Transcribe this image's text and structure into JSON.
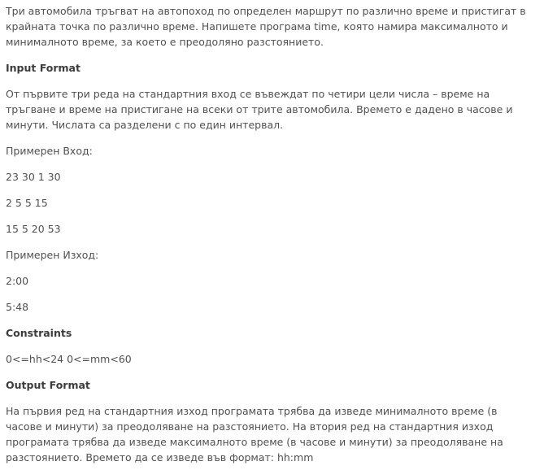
{
  "problem": {
    "intro": "Три автомобила тръгват на автопоход по определен маршрут по различно време и пристигат в крайната точка по различно време. Напишете програма time, която намира максималното и минималното време, за което е преодоляно разстоянието.",
    "input_format": {
      "heading": "Input Format",
      "text": "От първите три реда на стандартния вход се въвеждат по четири цели числа – време на тръгване и време на пристигане на всеки от трите автомобила. Времето е дадено в часове и минути. Числата са разделени с по един интервал.",
      "sample_input_label": "Примерен Вход:",
      "sample_input_lines": [
        "23 30 1 30",
        "2 5 5 15",
        "15 5 20 53"
      ],
      "sample_output_label": "Примерен Изход:",
      "sample_output_lines": [
        "2:00",
        "5:48"
      ]
    },
    "constraints": {
      "heading": "Constraints",
      "text": "0<=hh<24 0<=mm<60"
    },
    "output_format": {
      "heading": "Output Format",
      "text": "На първия ред на стандартния изход програмата трябва да изведе минималното време (в часове и минути) за преодоляване на разстоянието. На втория ред на стандартния изход програмата трябва да изведе максималното време (в часове и минути) за преодоляване на разстоянието. Времето да се изведе във формат: hh:mm"
    }
  }
}
